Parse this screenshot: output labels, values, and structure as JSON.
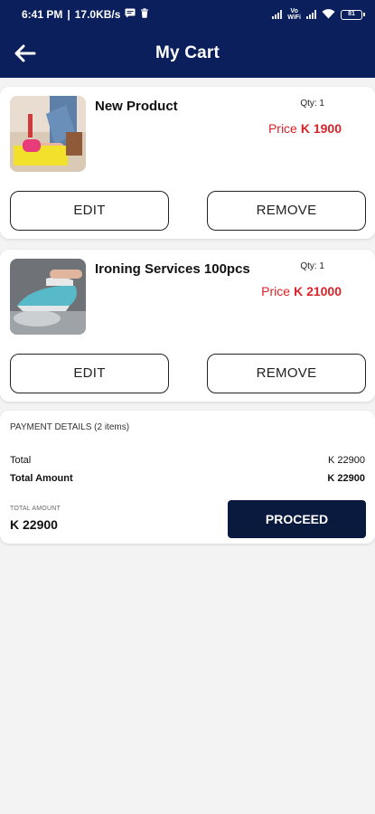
{
  "status_bar": {
    "time": "6:41 PM",
    "speed": "17.0KB/s",
    "battery": "81",
    "icons": [
      "message-icon",
      "trash-icon",
      "signal-icon",
      "volte-wifi-icon",
      "wifi-icon",
      "battery-icon"
    ],
    "volte_line1": "Vo",
    "volte_line2": "WiFi"
  },
  "app_bar": {
    "title": "My Cart",
    "back_icon": "arrow-left-icon"
  },
  "colors": {
    "primary": "#0a1f5c",
    "price_red": "#d8232a",
    "proceed_bg": "#0a1a3f",
    "background": "#f3f3f3"
  },
  "cart_items": [
    {
      "name": "New Product",
      "qty": "Qty: 1",
      "price_label": "Price",
      "price": "K 1900",
      "edit_label": "EDIT",
      "remove_label": "REMOVE"
    },
    {
      "name": "Ironing Services 100pcs",
      "qty": "Qty: 1",
      "price_label": "Price",
      "price": "K 21000",
      "edit_label": "EDIT",
      "remove_label": "REMOVE"
    }
  ],
  "payment": {
    "heading": "PAYMENT DETAILS (2 items)",
    "total_label": "Total",
    "total_value": "K 22900",
    "total_amount_label": "Total Amount",
    "total_amount_value": "K 22900",
    "footer_caption": "TOTAL AMOUNT",
    "footer_value": "K 22900",
    "proceed_label": "PROCEED"
  }
}
